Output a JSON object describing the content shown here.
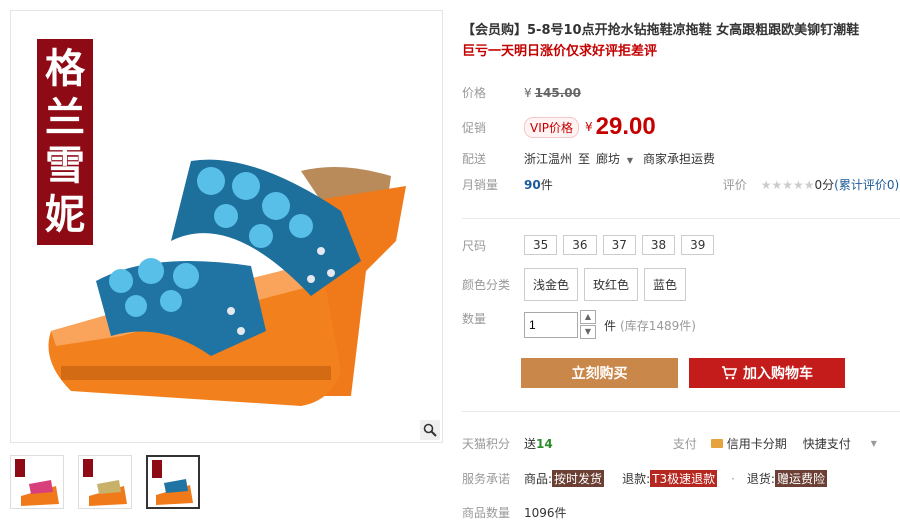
{
  "gallery": {
    "brand_chars": [
      "格",
      "兰",
      "雪",
      "妮"
    ],
    "thumb_brand": "格兰雪妮"
  },
  "product": {
    "title": "【会员购】5-8号10点开抢水钻拖鞋凉拖鞋 女高跟粗跟欧美铆钉潮鞋",
    "subtitle": "巨亏一天明日涨价仅求好评拒差评"
  },
  "price": {
    "label": "价格",
    "yen": "¥",
    "original": "145.00",
    "promo_label": "促销",
    "vip_badge": "VIP价格",
    "promo": "29.00"
  },
  "shipping": {
    "label": "配送",
    "from": "浙江温州",
    "to_word": "至",
    "dest": "廊坊",
    "fee": "商家承担运费"
  },
  "sales": {
    "label": "月销量",
    "count": "90",
    "unit": "件",
    "rating_label": "评价",
    "stars": "★★★★★",
    "score": "0分",
    "cumulative": "(累计评价0)"
  },
  "size": {
    "label": "尺码",
    "options": [
      "35",
      "36",
      "37",
      "38",
      "39"
    ]
  },
  "color": {
    "label": "颜色分类",
    "options": [
      "浅金色",
      "玫红色",
      "蓝色"
    ]
  },
  "quantity": {
    "label": "数量",
    "value": "1",
    "unit": "件",
    "stock": "(库存1489件)",
    "up": "▲",
    "down": "▼"
  },
  "actions": {
    "buy_now": "立刻购买",
    "add_cart": "加入购物车"
  },
  "points": {
    "label": "天猫积分",
    "give": "送",
    "value": "14",
    "pay_label": "支付",
    "credit": "信用卡分期",
    "quick": "快捷支付"
  },
  "service": {
    "label": "服务承诺",
    "item1_label": "商品:",
    "item1_tag": "按时发货",
    "item2_label": "退款:",
    "item2_tag": "T3极速退款",
    "item3_label": "退货:",
    "item3_tag": "赠运费险"
  },
  "review_count": {
    "label": "商品数量",
    "value": "1096件"
  },
  "colors": {
    "accent_red": "#c40000",
    "buy_button": "#c9874a",
    "cart_button": "#c41b1b",
    "brand_bg": "#8e0a15"
  }
}
